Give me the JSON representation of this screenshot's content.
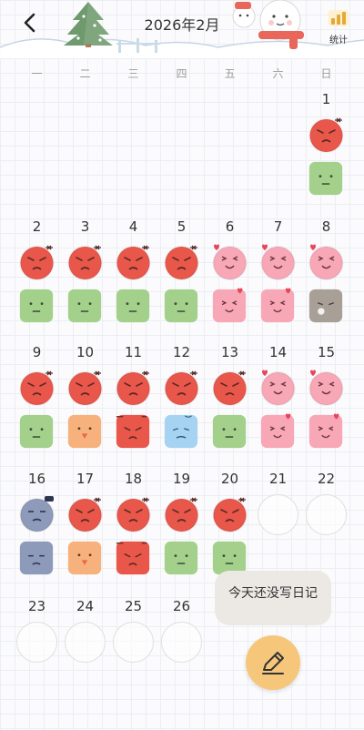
{
  "header": {
    "title": "2026年2月",
    "stats_label": "统计"
  },
  "weekdays": [
    "一",
    "二",
    "三",
    "四",
    "五",
    "六",
    "日"
  ],
  "colors": {
    "angry": "#e9574b",
    "happy": "#f8a7b6",
    "calm": "#a3d08a",
    "tired": "#8e9ab9",
    "excited": "#f7b17c",
    "sad": "#a7d3f2",
    "weary": "#a89f96",
    "accent": "#f6c77b"
  },
  "days": [
    {
      "num": "1",
      "mood": "angry",
      "square": "calm"
    },
    {
      "num": "2",
      "mood": "angry",
      "square": "calm"
    },
    {
      "num": "3",
      "mood": "angry",
      "square": "calm"
    },
    {
      "num": "4",
      "mood": "angry",
      "square": "calm"
    },
    {
      "num": "5",
      "mood": "angry",
      "square": "calm"
    },
    {
      "num": "6",
      "mood": "happy",
      "square": "happy"
    },
    {
      "num": "7",
      "mood": "happy",
      "square": "happy"
    },
    {
      "num": "8",
      "mood": "happy",
      "square": "weary"
    },
    {
      "num": "9",
      "mood": "angry",
      "square": "calm"
    },
    {
      "num": "10",
      "mood": "angry",
      "square": "excited"
    },
    {
      "num": "11",
      "mood": "angry",
      "square": "angry"
    },
    {
      "num": "12",
      "mood": "angry",
      "square": "sad"
    },
    {
      "num": "13",
      "mood": "angry",
      "square": "calm"
    },
    {
      "num": "14",
      "mood": "happy",
      "square": "happy"
    },
    {
      "num": "15",
      "mood": "happy",
      "square": "happy"
    },
    {
      "num": "16",
      "mood": "tired",
      "square": "tired"
    },
    {
      "num": "17",
      "mood": "angry",
      "square": "excited"
    },
    {
      "num": "18",
      "mood": "angry",
      "square": "angry"
    },
    {
      "num": "19",
      "mood": "angry",
      "square": "calm"
    },
    {
      "num": "20",
      "mood": "angry",
      "square": "calm"
    },
    {
      "num": "21",
      "mood": "empty",
      "square": "none"
    },
    {
      "num": "22",
      "mood": "empty",
      "square": "none"
    },
    {
      "num": "23",
      "mood": "empty",
      "square": "none"
    },
    {
      "num": "24",
      "mood": "empty",
      "square": "none"
    },
    {
      "num": "25",
      "mood": "empty",
      "square": "none"
    },
    {
      "num": "26",
      "mood": "empty",
      "square": "none"
    }
  ],
  "prompt": {
    "text": "今天还没写日记",
    "button_icon": "pencil-icon"
  }
}
